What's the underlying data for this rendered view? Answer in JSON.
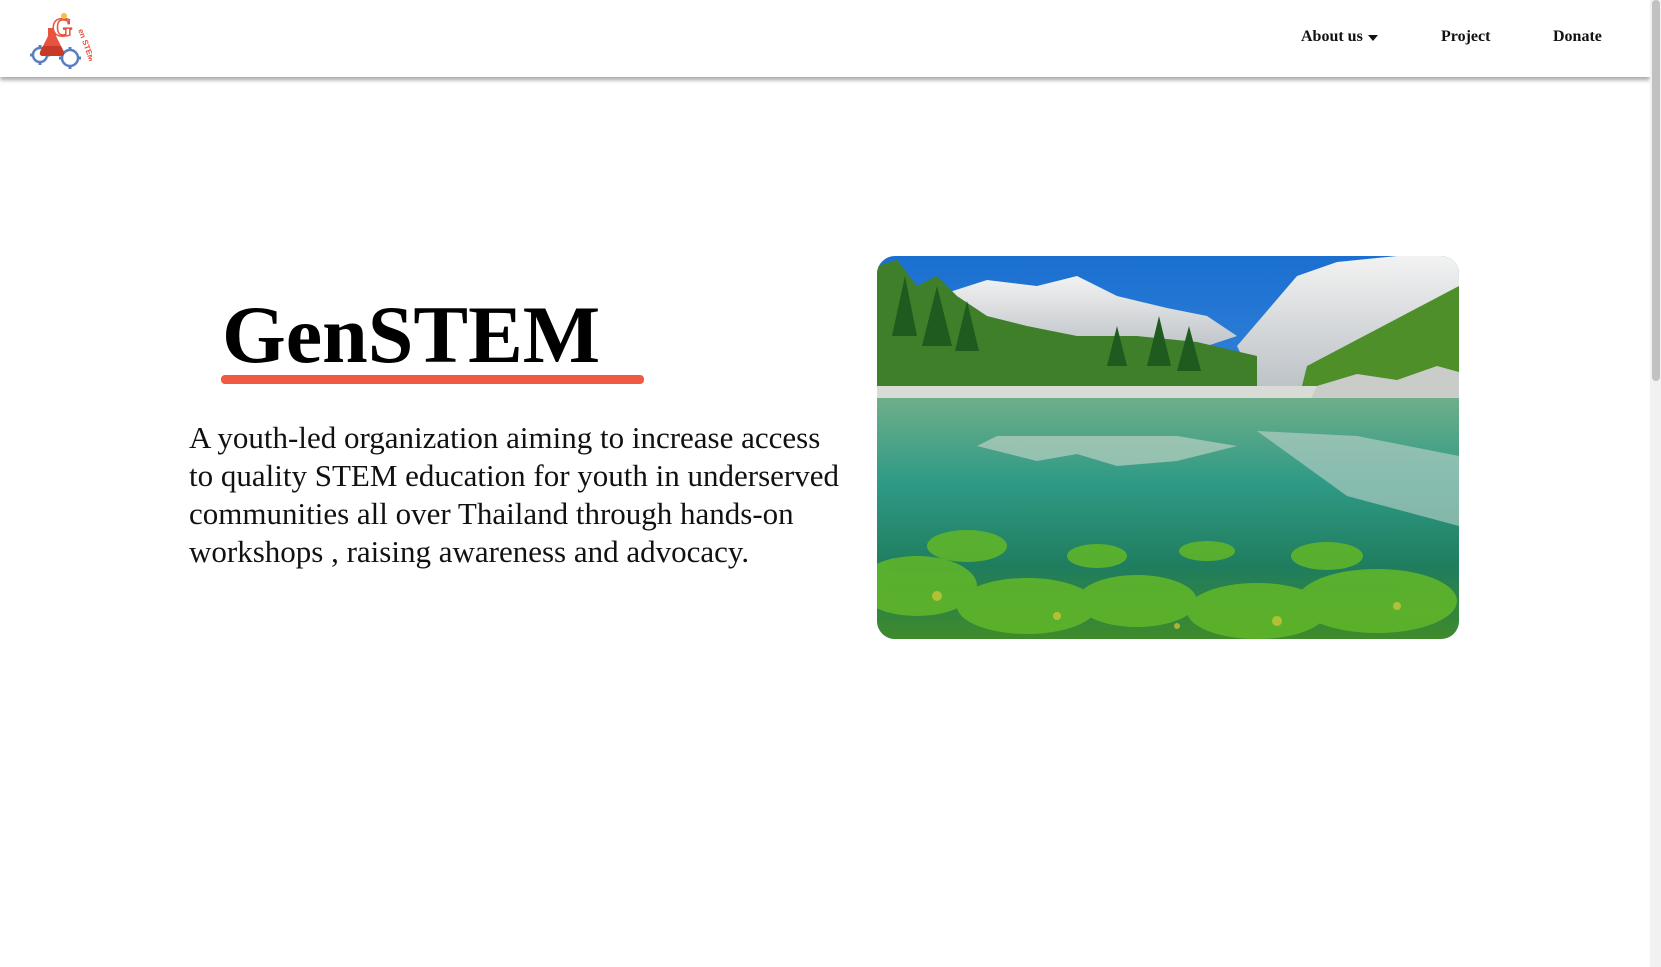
{
  "navbar": {
    "logo_alt": "GenSTEM",
    "items": [
      {
        "label": "About us",
        "has_dropdown": true,
        "icon": "caret-down-icon"
      },
      {
        "label": "Project"
      },
      {
        "label": "Donate"
      }
    ]
  },
  "hero": {
    "title": "GenSTEM",
    "description": "A youth-led organization aiming to increase access to quality STEM education for youth in underserved communities all over Thailand through hands-on workshops , raising awareness and advocacy.",
    "image": "mountain-lake-photo"
  },
  "colors": {
    "accent": "#f05a45",
    "text": "#111111",
    "background": "#ffffff"
  }
}
